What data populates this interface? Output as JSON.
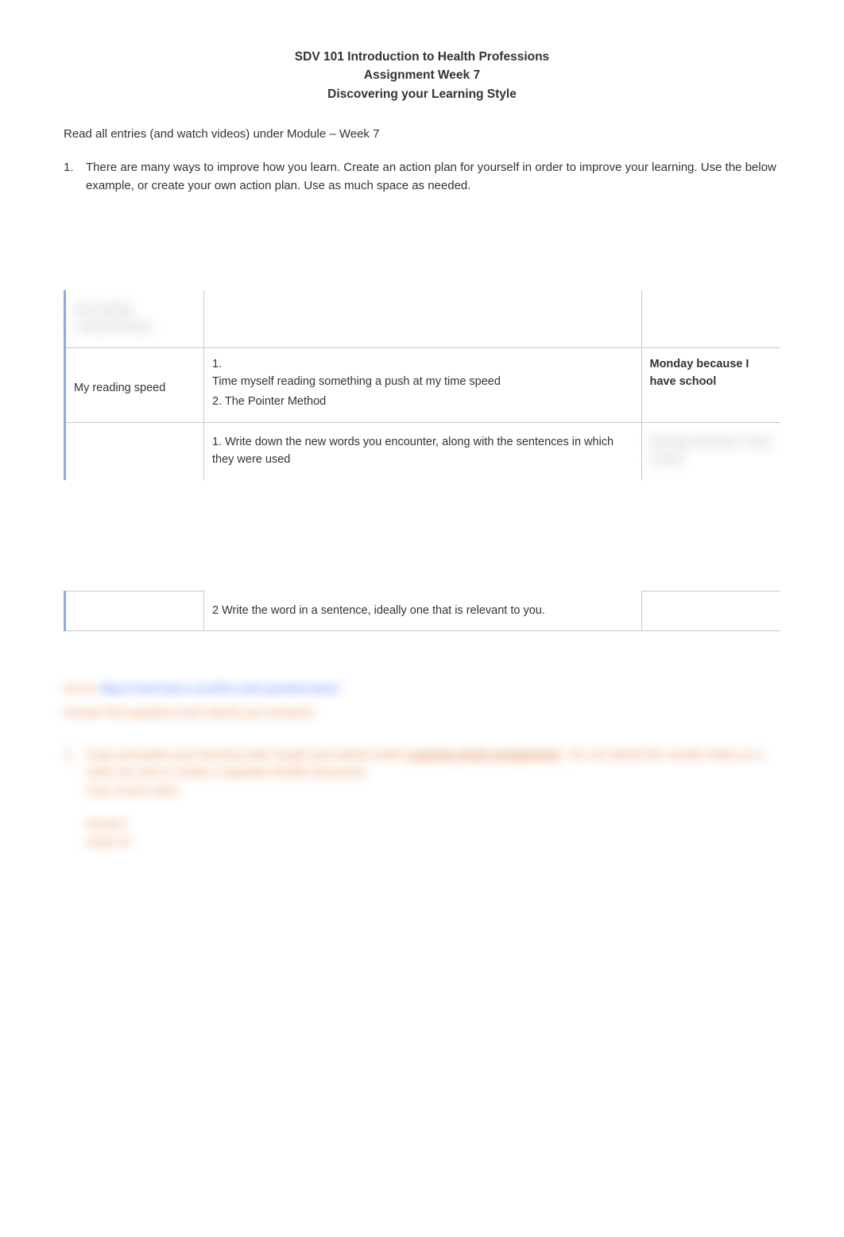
{
  "header": {
    "line1": "SDV 101 Introduction to Health Professions",
    "line2": "Assignment Week 7",
    "line3": "Discovering your Learning Style"
  },
  "intro": "Read all entries (and watch videos) under Module – Week 7",
  "item1": {
    "num": "1.",
    "text": "There are many ways to improve how you learn.   Create an action plan for yourself in order to improve your learning.   Use the below example, or create your own action plan.   Use as much space as needed."
  },
  "table": {
    "row_blur_header": {
      "col1": "My reading comprehension"
    },
    "row2": {
      "col1": "My reading speed",
      "col2_line1_num": "1.",
      "col2_line1": "Time myself reading something a push at my time speed",
      "col2_line2": "2.  The Pointer Method",
      "col3": "Monday because I have school"
    },
    "row3": {
      "col2": "1.  Write down the new words you encounter, along with the sentences in which they were used",
      "col3_blur": "Monday because I have school"
    },
    "row4": {
      "col2": "2 Write the word in a sentence, ideally one that is relevant to you."
    }
  },
  "bottom": {
    "goto": "Go to:  ",
    "link": "https://vark-learn.com/the-vark-questionnaire/",
    "answer": "Answer the questions and submit your answers.",
    "item2_num": "2.",
    "item2_text_a": "Copy and paste your learning style results and submit under",
    "item2_text_link": " Learning Style Assignment",
    "item2_text_b": ".   Do not submit the results online as a chart, be sure to create a separate WORD document.",
    "scores": "Your scores were:",
    "visual": "Visual 2",
    "aural": "Aural 10"
  }
}
